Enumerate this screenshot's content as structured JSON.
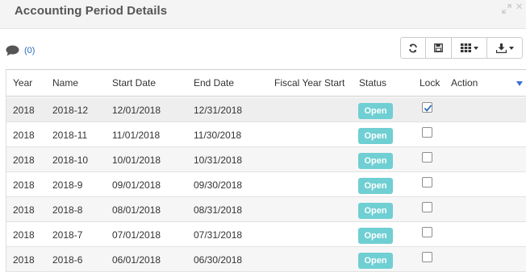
{
  "panel": {
    "title": "Accounting Period Details"
  },
  "comments": {
    "count_label": "(0)"
  },
  "toolbar": {
    "buttons": [
      "refresh-icon",
      "save-icon",
      "columns-icon",
      "export-icon"
    ]
  },
  "grid": {
    "columns": {
      "year": "Year",
      "name": "Name",
      "start_date": "Start Date",
      "end_date": "End Date",
      "fiscal_year_start": "Fiscal Year Start",
      "status": "Status",
      "lock": "Lock",
      "action": "Action"
    },
    "rows": [
      {
        "year": "2018",
        "name": "2018-12",
        "start_date": "12/01/2018",
        "end_date": "12/31/2018",
        "status": "Open",
        "locked": true
      },
      {
        "year": "2018",
        "name": "2018-11",
        "start_date": "11/01/2018",
        "end_date": "11/30/2018",
        "status": "Open",
        "locked": false
      },
      {
        "year": "2018",
        "name": "2018-10",
        "start_date": "10/01/2018",
        "end_date": "10/31/2018",
        "status": "Open",
        "locked": false
      },
      {
        "year": "2018",
        "name": "2018-9",
        "start_date": "09/01/2018",
        "end_date": "09/30/2018",
        "status": "Open",
        "locked": false
      },
      {
        "year": "2018",
        "name": "2018-8",
        "start_date": "08/01/2018",
        "end_date": "08/31/2018",
        "status": "Open",
        "locked": false
      },
      {
        "year": "2018",
        "name": "2018-7",
        "start_date": "07/01/2018",
        "end_date": "07/31/2018",
        "status": "Open",
        "locked": false
      },
      {
        "year": "2018",
        "name": "2018-6",
        "start_date": "06/01/2018",
        "end_date": "06/30/2018",
        "status": "Open",
        "locked": false
      }
    ]
  },
  "colors": {
    "status_badge": "#6fcfd3",
    "link": "#2a6ebb",
    "sort_indicator": "#3a6fd8",
    "checkbox_check": "#2a6ebb"
  }
}
